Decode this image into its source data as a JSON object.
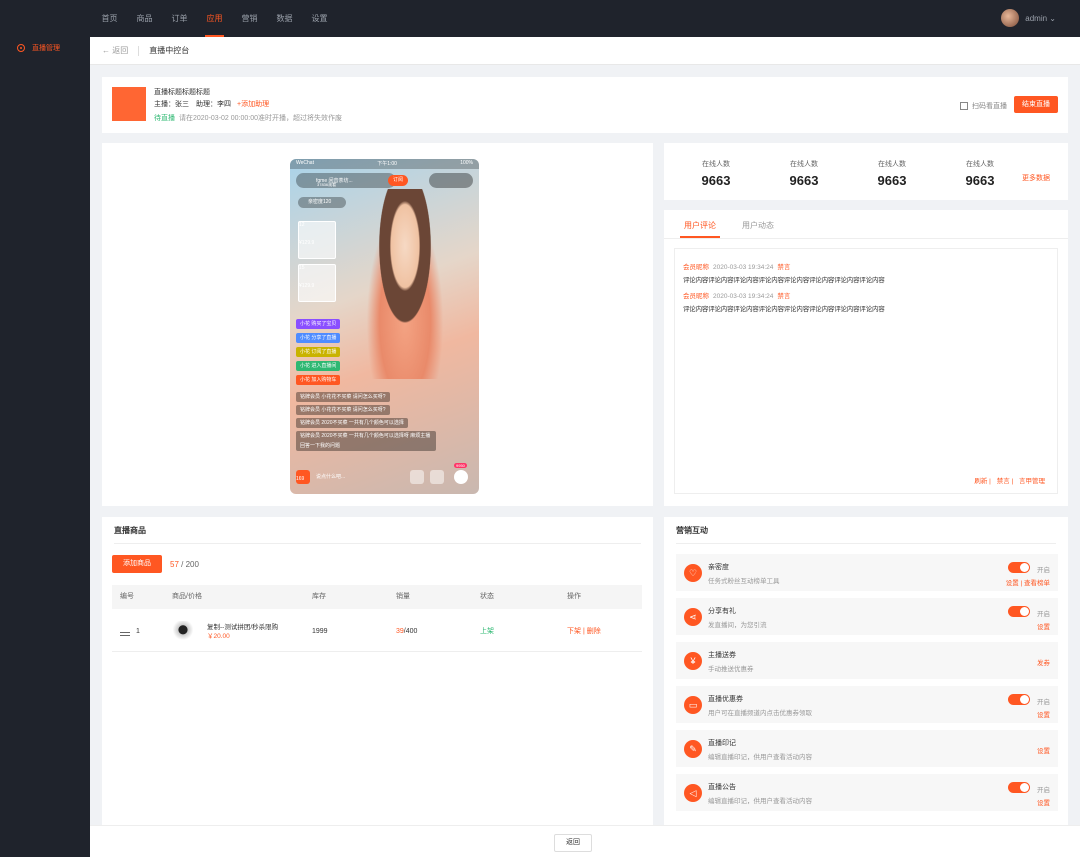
{
  "topnav": {
    "items": [
      "首页",
      "商品",
      "订单",
      "应用",
      "营销",
      "数据",
      "设置"
    ],
    "active_index": 3,
    "user": "admin ⌄"
  },
  "sidebar": {
    "items": [
      {
        "label": "直播管理",
        "icon": "settings-circle-icon"
      }
    ]
  },
  "breadcrumb": {
    "back": "← 返回",
    "title": "直播中控台"
  },
  "live_info": {
    "title": "直播标题标题标题",
    "host_line": "主播：张三　助理：李四",
    "add_assistant": "+添加助理",
    "status": "待直播",
    "notice": "请在2020-03-02 00:00:00准时开播，超过将失效作废",
    "scan": "扫码看直播",
    "end_button": "结束直播",
    "accent": "#ff5722"
  },
  "phone": {
    "carrier": "WeChat",
    "time": "下午1:00",
    "battery": "100%",
    "host_name": "fgme 闲音茶坊...",
    "watchers": "37836观看",
    "subscribe": "订阅",
    "fans": "亲密度120",
    "products": [
      {
        "num": "12",
        "price": "¥129.9"
      },
      {
        "num": "15",
        "price": "¥129.9"
      }
    ],
    "events": [
      {
        "text": "小花 购买了宝贝",
        "color": "#8a4fff"
      },
      {
        "text": "小花 分享了直播",
        "color": "#4f8cff"
      },
      {
        "text": "小花 订阅了直播",
        "color": "#c9b300"
      },
      {
        "text": "小花 进入直播间",
        "color": "#2eb872"
      },
      {
        "text": "小花 加入购物车",
        "color": "#ff5722"
      }
    ],
    "comments": [
      "铭牌会员 小花花不买菜 请问怎么买呀?",
      "铭牌会员 小花花不买菜 请问怎么买呀?",
      "铭牌会员 2020不买菜 一共有几个颜色可以选择",
      "铭牌会员 2020不买菜 一共有几个颜色可以选择呀 麻烦主播回答一下我的问题"
    ],
    "cart_count": "169",
    "input_hint": "说点什么吧...",
    "likes": "9950"
  },
  "stats": {
    "items": [
      {
        "label": "在线人数",
        "value": "9663"
      },
      {
        "label": "在线人数",
        "value": "9663"
      },
      {
        "label": "在线人数",
        "value": "9663"
      },
      {
        "label": "在线人数",
        "value": "9663"
      }
    ],
    "more": "更多数据"
  },
  "comments_panel": {
    "tabs": [
      "用户评论",
      "用户动态"
    ],
    "active_tab": 0,
    "items": [
      {
        "user": "会员昵称",
        "time": "2020-03-03 19:34:24",
        "ban": "禁言",
        "text": "评论内容评论内容评论内容评论内容评论内容评论内容评论内容评论内容"
      },
      {
        "user": "会员昵称",
        "time": "2020-03-03 19:34:24",
        "ban": "禁言",
        "text": "评论内容评论内容评论内容评论内容评论内容评论内容评论内容评论内容"
      }
    ],
    "actions": [
      "刷新",
      "禁言",
      "言甲管理"
    ]
  },
  "goods": {
    "title": "直播商品",
    "add_button": "添加商品",
    "count": "57",
    "total": "/ 200",
    "columns": [
      "编号",
      "商品/价格",
      "库存",
      "销量",
      "状态",
      "操作"
    ],
    "rows": [
      {
        "index": "1",
        "name": "复制--测试拼团/秒杀限购",
        "price": "￥20.00",
        "stock": "1999",
        "sold": "39",
        "sold_total": "/400",
        "status": "上架",
        "ops": "下架 | 删除"
      }
    ]
  },
  "marketing": {
    "title": "营销互动",
    "items": [
      {
        "icon": "heart-icon",
        "glyph": "♡",
        "name": "亲密度",
        "desc": "任务式粉丝互动榜单工具",
        "toggle": true,
        "on_label": "开启",
        "links": "设置 | 查看榜单"
      },
      {
        "icon": "share-icon",
        "glyph": "⋖",
        "name": "分享有礼",
        "desc": "发直播间，为您引流",
        "toggle": true,
        "on_label": "开启",
        "links": "设置"
      },
      {
        "icon": "yen-icon",
        "glyph": "¥",
        "name": "主播送券",
        "desc": "手动推送优惠券",
        "toggle": false,
        "on_label": "",
        "links": "发券"
      },
      {
        "icon": "coupon-icon",
        "glyph": "▭",
        "name": "直播优惠券",
        "desc": "用户可在直播频道内点击优惠券领取",
        "toggle": true,
        "on_label": "开启",
        "links": "设置"
      },
      {
        "icon": "notes-icon",
        "glyph": "✎",
        "name": "直播印记",
        "desc": "编辑直播印记，供用户查看活动内容",
        "toggle": false,
        "on_label": "",
        "links": "设置"
      },
      {
        "icon": "announcement-icon",
        "glyph": "◁",
        "name": "直播公告",
        "desc": "编辑直播印记，供用户查看活动内容",
        "toggle": true,
        "on_label": "开启",
        "links": "设置"
      }
    ]
  },
  "footer": {
    "back_button": "返回"
  }
}
